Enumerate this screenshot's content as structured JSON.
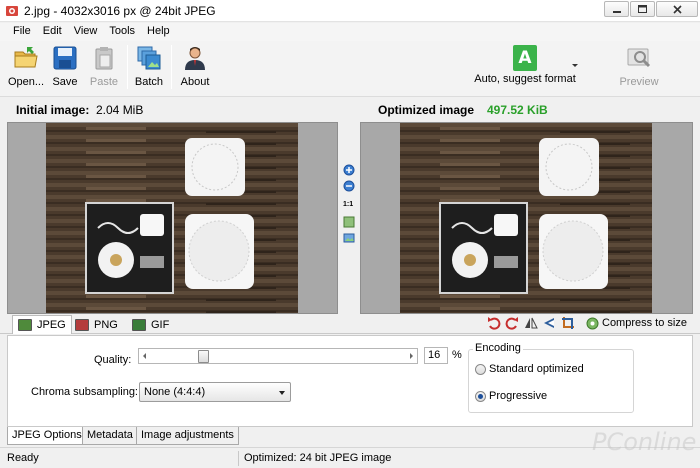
{
  "window": {
    "title": "2.jpg - 4032x3016 px @ 24bit JPEG"
  },
  "menu": [
    "File",
    "Edit",
    "View",
    "Tools",
    "Help"
  ],
  "toolbar": {
    "open": "Open...",
    "save": "Save",
    "paste": "Paste",
    "batch": "Batch",
    "about": "About",
    "format_icon": "A",
    "format": "Auto, suggest format",
    "preview": "Preview"
  },
  "sizes": {
    "initial_label": "Initial image:",
    "initial_value": "2.04 MiB",
    "optimized_label": "Optimized image",
    "optimized_value": "497.52 KiB",
    "optimized_color": "#2aa02a"
  },
  "zoom": {
    "one_to_one": "1:1"
  },
  "format_tabs": [
    {
      "label": "JPEG",
      "icon": "jpeg-file-icon",
      "active": true
    },
    {
      "label": "PNG",
      "icon": "png-file-icon",
      "active": false
    },
    {
      "label": "GIF",
      "icon": "gif-file-icon",
      "active": false
    }
  ],
  "tools": {
    "icons": [
      "rotate-left-icon",
      "rotate-right-icon",
      "flip-horizontal-icon",
      "flip-vertical-icon",
      "crop-icon"
    ],
    "compress_label": "Compress to size"
  },
  "options": {
    "quality_label": "Quality:",
    "quality_value": "16",
    "quality_fraction": 0.16,
    "percent": "%",
    "chroma_label": "Chroma subsampling:",
    "chroma_value": "None (4:4:4)",
    "encoding_title": "Encoding",
    "encoding_options": [
      {
        "label": "Standard optimized",
        "selected": false
      },
      {
        "label": "Progressive",
        "selected": true
      }
    ]
  },
  "bottom_tabs": [
    "JPEG Options",
    "Metadata",
    "Image adjustments"
  ],
  "status": {
    "left": "Ready",
    "middle": "Optimized: 24 bit JPEG image"
  },
  "watermark": "PConline"
}
